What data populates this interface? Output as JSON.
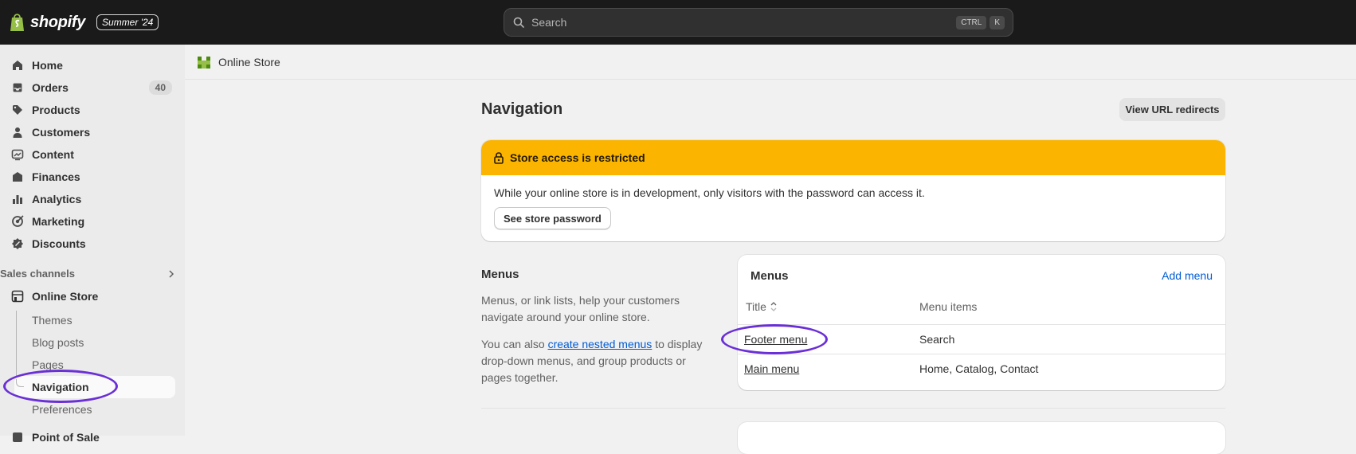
{
  "topbar": {
    "brand": "shopify",
    "edition": "Summer '24",
    "search_placeholder": "Search",
    "shortcut_keys": [
      "CTRL",
      "K"
    ]
  },
  "sidebar": {
    "items": [
      {
        "label": "Home",
        "icon": "home-icon"
      },
      {
        "label": "Orders",
        "icon": "inbox-icon",
        "count": "40"
      },
      {
        "label": "Products",
        "icon": "tag-icon"
      },
      {
        "label": "Customers",
        "icon": "person-icon"
      },
      {
        "label": "Content",
        "icon": "image-icon"
      },
      {
        "label": "Finances",
        "icon": "bank-icon"
      },
      {
        "label": "Analytics",
        "icon": "bar-chart-icon"
      },
      {
        "label": "Marketing",
        "icon": "target-icon"
      },
      {
        "label": "Discounts",
        "icon": "discount-icon"
      }
    ],
    "sales_channels_label": "Sales channels",
    "channel": {
      "label": "Online Store",
      "icon": "store-icon"
    },
    "subitems": [
      "Themes",
      "Blog posts",
      "Pages",
      "Navigation",
      "Preferences"
    ],
    "active_subitem": "Navigation",
    "cut_off_item": "Point of Sale"
  },
  "breadcrumb": {
    "label": "Online Store"
  },
  "page": {
    "title": "Navigation",
    "url_redirects_button": "View URL redirects"
  },
  "banner": {
    "title": "Store access is restricted",
    "message": "While your online store is in development, only visitors with the password can access it.",
    "button": "See store password",
    "color": "#fbb500"
  },
  "menus_section": {
    "heading": "Menus",
    "description": "Menus, or link lists, help your customers navigate around your online store.",
    "text_before_link": "You can also ",
    "link_text": "create nested menus",
    "text_after_link": " to display drop-down menus, and group products or pages together."
  },
  "menus_card": {
    "title": "Menus",
    "add_button": "Add menu",
    "columns": [
      "Title",
      "Menu items"
    ],
    "rows": [
      {
        "title": "Footer menu",
        "items": "Search"
      },
      {
        "title": "Main menu",
        "items": "Home, Catalog, Contact"
      }
    ]
  },
  "annotation_color": "#6a2fd6"
}
